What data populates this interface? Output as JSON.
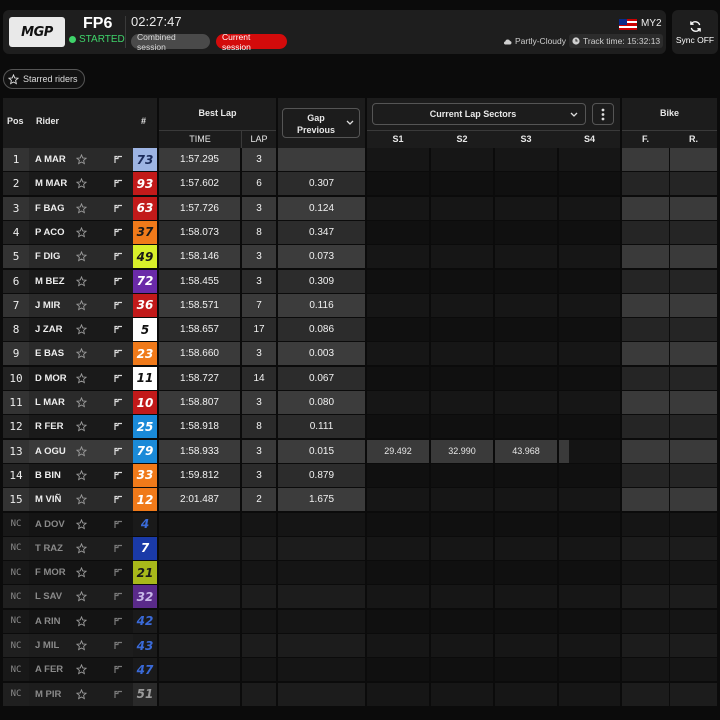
{
  "header": {
    "logo_text": "MGP",
    "session_name": "FP6",
    "session_status": "STARTED",
    "clock": "02:27:47",
    "combined_label": "Combined session",
    "current_label": "Current session",
    "country": "MY2",
    "weather": "Partly-Cloudy",
    "track_time": "Track time: 15:32:13",
    "sync_label": "Sync OFF",
    "colors": {
      "status": "#3fd36a",
      "current": "#d30b0b"
    }
  },
  "starred_label": "Starred riders",
  "columns": {
    "pos": "Pos",
    "rider": "Rider",
    "num": "#",
    "best_lap": "Best Lap",
    "time": "TIME",
    "lap": "LAP",
    "gap": "Gap Previous",
    "sectors": "Current Lap Sectors",
    "s1": "S1",
    "s2": "S2",
    "s3": "S3",
    "s4": "S4",
    "bike": "Bike",
    "front": "F.",
    "rear": "R."
  },
  "riders": [
    {
      "pos": "1",
      "name": "A MAR",
      "num": "73",
      "numBg": "#9db4e3",
      "numColor": "#1a2a5a",
      "time": "1:57.295",
      "lap": "3",
      "gap": "",
      "s1": "",
      "s2": "",
      "s3": "",
      "active": false
    },
    {
      "pos": "2",
      "name": "M MAR",
      "num": "93",
      "numBg": "#c21a1a",
      "numColor": "#ffffff",
      "time": "1:57.602",
      "lap": "6",
      "gap": "0.307",
      "s1": "",
      "s2": "",
      "s3": "",
      "active": false
    },
    {
      "pos": "3",
      "name": "F BAG",
      "num": "63",
      "numBg": "#c21a1a",
      "numColor": "#ffffff",
      "time": "1:57.726",
      "lap": "3",
      "gap": "0.124",
      "s1": "",
      "s2": "",
      "s3": "",
      "active": false
    },
    {
      "pos": "4",
      "name": "P ACO",
      "num": "37",
      "numBg": "#f07a1a",
      "numColor": "#1a1a1a",
      "time": "1:58.073",
      "lap": "8",
      "gap": "0.347",
      "s1": "",
      "s2": "",
      "s3": "",
      "active": false
    },
    {
      "pos": "5",
      "name": "F DIG",
      "num": "49",
      "numBg": "#d8f02a",
      "numColor": "#1a1a1a",
      "time": "1:58.146",
      "lap": "3",
      "gap": "0.073",
      "s1": "",
      "s2": "",
      "s3": "",
      "active": false
    },
    {
      "pos": "6",
      "name": "M BEZ",
      "num": "72",
      "numBg": "#6a2aa8",
      "numColor": "#ffffff",
      "time": "1:58.455",
      "lap": "3",
      "gap": "0.309",
      "s1": "",
      "s2": "",
      "s3": "",
      "active": false
    },
    {
      "pos": "7",
      "name": "J MIR",
      "num": "36",
      "numBg": "#c21a1a",
      "numColor": "#ffffff",
      "time": "1:58.571",
      "lap": "7",
      "gap": "0.116",
      "s1": "",
      "s2": "",
      "s3": "",
      "active": false
    },
    {
      "pos": "8",
      "name": "J ZAR",
      "num": "5",
      "numBg": "#ffffff",
      "numColor": "#111111",
      "time": "1:58.657",
      "lap": "17",
      "gap": "0.086",
      "s1": "",
      "s2": "",
      "s3": "",
      "active": false
    },
    {
      "pos": "9",
      "name": "E BAS",
      "num": "23",
      "numBg": "#f07a1a",
      "numColor": "#ffffff",
      "time": "1:58.660",
      "lap": "3",
      "gap": "0.003",
      "s1": "",
      "s2": "",
      "s3": "",
      "active": false
    },
    {
      "pos": "10",
      "name": "D MOR",
      "num": "11",
      "numBg": "#ffffff",
      "numColor": "#111111",
      "time": "1:58.727",
      "lap": "14",
      "gap": "0.067",
      "s1": "",
      "s2": "",
      "s3": "",
      "active": false
    },
    {
      "pos": "11",
      "name": "L MAR",
      "num": "10",
      "numBg": "#c21a1a",
      "numColor": "#ffffff",
      "time": "1:58.807",
      "lap": "3",
      "gap": "0.080",
      "s1": "",
      "s2": "",
      "s3": "",
      "active": false
    },
    {
      "pos": "12",
      "name": "R FER",
      "num": "25",
      "numBg": "#1a8ad8",
      "numColor": "#ffffff",
      "time": "1:58.918",
      "lap": "8",
      "gap": "0.111",
      "s1": "",
      "s2": "",
      "s3": "",
      "active": false
    },
    {
      "pos": "13",
      "name": "A OGU",
      "num": "79",
      "numBg": "#1a8ad8",
      "numColor": "#ffffff",
      "time": "1:58.933",
      "lap": "3",
      "gap": "0.015",
      "s1": "29.492",
      "s2": "32.990",
      "s3": "43.968",
      "active": true
    },
    {
      "pos": "14",
      "name": "B BIN",
      "num": "33",
      "numBg": "#f07a1a",
      "numColor": "#ffffff",
      "time": "1:59.812",
      "lap": "3",
      "gap": "0.879",
      "s1": "",
      "s2": "",
      "s3": "",
      "active": false
    },
    {
      "pos": "15",
      "name": "M VIÑ",
      "num": "12",
      "numBg": "#f07a1a",
      "numColor": "#ffffff",
      "time": "2:01.487",
      "lap": "2",
      "gap": "1.675",
      "s1": "",
      "s2": "",
      "s3": "",
      "active": false
    },
    {
      "pos": "NC",
      "name": "A DOV",
      "num": "4",
      "numBg": "#1a1a1a",
      "numColor": "#3a6ad8",
      "time": "",
      "lap": "",
      "gap": "",
      "s1": "",
      "s2": "",
      "s3": "",
      "active": false
    },
    {
      "pos": "NC",
      "name": "T RAZ",
      "num": "7",
      "numBg": "#1a3aa8",
      "numColor": "#ffffff",
      "time": "",
      "lap": "",
      "gap": "",
      "s1": "",
      "s2": "",
      "s3": "",
      "active": false
    },
    {
      "pos": "NC",
      "name": "F MOR",
      "num": "21",
      "numBg": "#a8b81a",
      "numColor": "#1a1a1a",
      "time": "",
      "lap": "",
      "gap": "",
      "s1": "",
      "s2": "",
      "s3": "",
      "active": false
    },
    {
      "pos": "NC",
      "name": "L SAV",
      "num": "32",
      "numBg": "#5a2a8a",
      "numColor": "#c8b8e8",
      "time": "",
      "lap": "",
      "gap": "",
      "s1": "",
      "s2": "",
      "s3": "",
      "active": false
    },
    {
      "pos": "NC",
      "name": "A RIN",
      "num": "42",
      "numBg": "#1a1a1a",
      "numColor": "#3a6ad8",
      "time": "",
      "lap": "",
      "gap": "",
      "s1": "",
      "s2": "",
      "s3": "",
      "active": false
    },
    {
      "pos": "NC",
      "name": "J MIL",
      "num": "43",
      "numBg": "#1a1a1a",
      "numColor": "#3a6ad8",
      "time": "",
      "lap": "",
      "gap": "",
      "s1": "",
      "s2": "",
      "s3": "",
      "active": false
    },
    {
      "pos": "NC",
      "name": "A FER",
      "num": "47",
      "numBg": "#1a1a1a",
      "numColor": "#3a6ad8",
      "time": "",
      "lap": "",
      "gap": "",
      "s1": "",
      "s2": "",
      "s3": "",
      "active": false
    },
    {
      "pos": "NC",
      "name": "M PIR",
      "num": "51",
      "numBg": "#2a2a2a",
      "numColor": "#9a9a9a",
      "time": "",
      "lap": "",
      "gap": "",
      "s1": "",
      "s2": "",
      "s3": "",
      "active": false
    }
  ]
}
